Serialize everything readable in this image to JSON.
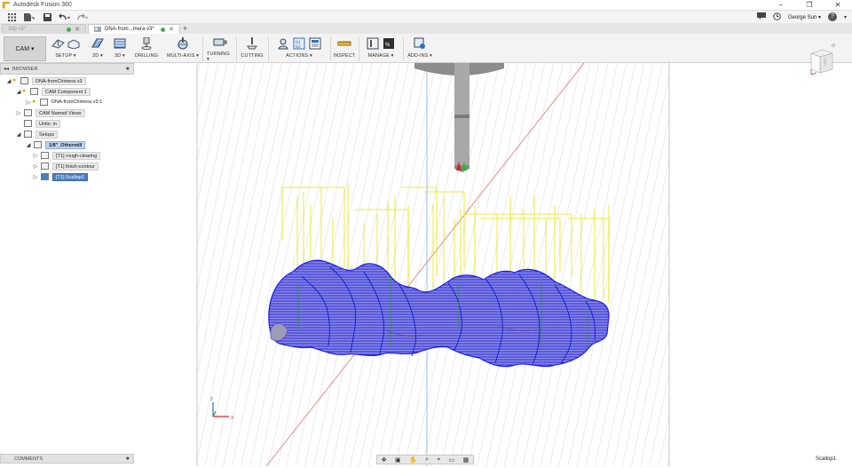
{
  "app": {
    "title": "Autodesk Fusion 360"
  },
  "window_controls": {
    "minimize": "–",
    "restore": "❐",
    "close": "✕"
  },
  "qat": {
    "user": "George Sun",
    "help": "?"
  },
  "tabs": [
    {
      "label": "3dp v5*",
      "active": false
    },
    {
      "label": "DNA-from...mera v3*",
      "active": true
    }
  ],
  "workspace": {
    "label": "CAM ▾"
  },
  "toolbar_groups": [
    {
      "label": "SETUP ▾"
    },
    {
      "label": "2D ▾"
    },
    {
      "label": "3D ▾"
    },
    {
      "label": "DRILLING"
    },
    {
      "label": "MULTI-AXIS ▾"
    },
    {
      "label": "TURNING ▾"
    },
    {
      "label": "CUTTING"
    },
    {
      "label": "ACTIONS ▾"
    },
    {
      "label": "INSPECT"
    },
    {
      "label": "MANAGE ▾"
    },
    {
      "label": "ADD-INS ▾"
    }
  ],
  "browser": {
    "title": "BROWSER"
  },
  "tree": {
    "root": "DNA-fromChimera v3",
    "component": "CAM Component 1",
    "subcomponent": "DNA-fromChimera v3:1",
    "named_views": "CAM Named Views",
    "units": "Units: in",
    "setups": "Setups",
    "setup": "1/8\"_Othermill",
    "ops": [
      "[T1] rough-clearing",
      "[T1] finish-contour",
      "[T1] Scallop1"
    ]
  },
  "comments": {
    "title": "COMMENTS"
  },
  "status": {
    "selection": "Scallop1"
  },
  "colors": {
    "toolpath": "#1a1aff",
    "rapid": "#e6e600",
    "stock": "#6a6ad0"
  }
}
